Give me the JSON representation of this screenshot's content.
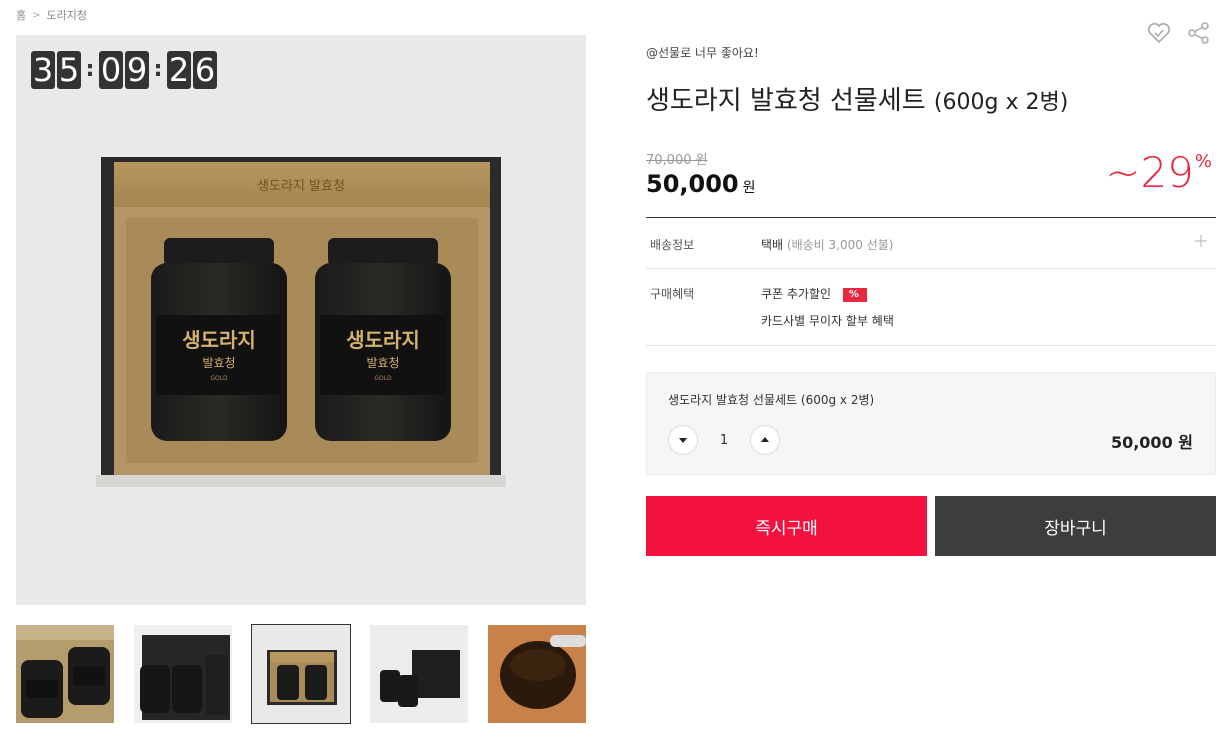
{
  "breadcrumb": {
    "home": "홈",
    "current": "도라지청"
  },
  "timer": {
    "hours": [
      "3",
      "5"
    ],
    "minutes": [
      "0",
      "9"
    ],
    "seconds": [
      "2",
      "6"
    ]
  },
  "icons": {
    "wishlist": "heart-check-icon",
    "share": "share-icon"
  },
  "product": {
    "tagline": "@선물로 너무 좋아요!",
    "title": "생도라지 발효청 선물세트",
    "title_suffix": "(600g x 2병)",
    "original_price": "70,000 원",
    "price": "50,000",
    "price_unit": "원",
    "discount_prefix": "~",
    "discount_value": "29",
    "discount_unit": "%"
  },
  "info": {
    "shipping": {
      "label": "배송정보",
      "value": "택배",
      "note": "(배송비 3,000 선불)"
    },
    "benefit": {
      "label": "구매혜택",
      "coupon": "쿠폰 추가할인",
      "coupon_badge": "%",
      "card": "카드사별 무이자 할부 혜택"
    }
  },
  "option": {
    "name": "생도라지 발효청 선물세트 (600g x 2병)",
    "quantity": "1",
    "price": "50,000 원"
  },
  "buttons": {
    "buy": "즉시구매",
    "cart": "장바구니"
  },
  "colors": {
    "accent": "#f2113f",
    "discount": "#e8293f",
    "cart": "#3d3d3d"
  }
}
